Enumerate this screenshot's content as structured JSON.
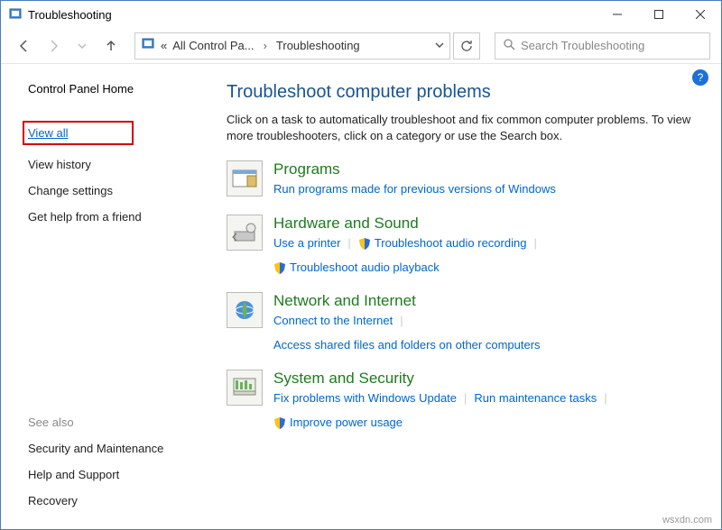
{
  "window": {
    "title": "Troubleshooting"
  },
  "breadcrumb": {
    "prefix": "«",
    "item1": "All Control Pa...",
    "item2": "Troubleshooting"
  },
  "search": {
    "placeholder": "Search Troubleshooting"
  },
  "sidebar": {
    "home": "Control Panel Home",
    "links": [
      "View all",
      "View history",
      "Change settings",
      "Get help from a friend"
    ],
    "see_also_h": "See also",
    "see_also": [
      "Security and Maintenance",
      "Help and Support",
      "Recovery"
    ]
  },
  "main": {
    "heading": "Troubleshoot computer problems",
    "desc": "Click on a task to automatically troubleshoot and fix common computer problems. To view more troubleshooters, click on a category or use the Search box."
  },
  "cats": {
    "programs": {
      "title": "Programs",
      "link1": "Run programs made for previous versions of Windows"
    },
    "hardware": {
      "title": "Hardware and Sound",
      "link1": "Use a printer",
      "link2": "Troubleshoot audio recording",
      "link3": "Troubleshoot audio playback"
    },
    "network": {
      "title": "Network and Internet",
      "link1": "Connect to the Internet",
      "link2": "Access shared files and folders on other computers"
    },
    "system": {
      "title": "System and Security",
      "link1": "Fix problems with Windows Update",
      "link2": "Run maintenance tasks",
      "link3": "Improve power usage"
    }
  },
  "watermark": "wsxdn.com"
}
